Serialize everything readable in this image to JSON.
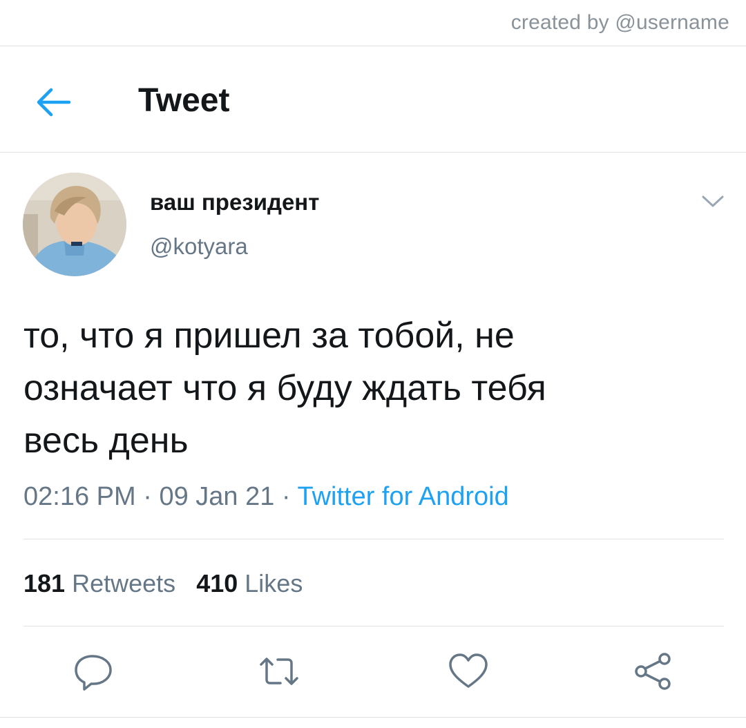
{
  "watermark": {
    "text": "created by @username"
  },
  "header": {
    "back_icon": "arrow-left-icon",
    "title": "Tweet"
  },
  "tweet": {
    "author": {
      "display_name": "ваш президент",
      "handle": "@kotyara",
      "avatar": "user-avatar-photo"
    },
    "more_icon": "chevron-down-icon",
    "text_lines": [
      "то, что я пришел за тобой, не",
      "означает что я буду ждать тебя",
      "весь день"
    ],
    "time": "02:16 PM",
    "date": "09 Jan 21",
    "separator": "·",
    "source": "Twitter for Android",
    "stats": {
      "retweets_count": "181",
      "retweets_label": "Retweets",
      "likes_count": "410",
      "likes_label": "Likes"
    }
  },
  "actions": [
    {
      "name": "reply",
      "icon": "reply-icon"
    },
    {
      "name": "retweet",
      "icon": "retweet-icon"
    },
    {
      "name": "like",
      "icon": "heart-icon"
    },
    {
      "name": "share",
      "icon": "share-icon"
    }
  ],
  "colors": {
    "accent": "#1da1f2",
    "text_primary": "#14171a",
    "text_secondary": "#657786",
    "divider": "#dfe3e6",
    "watermark": "#8a9299"
  }
}
